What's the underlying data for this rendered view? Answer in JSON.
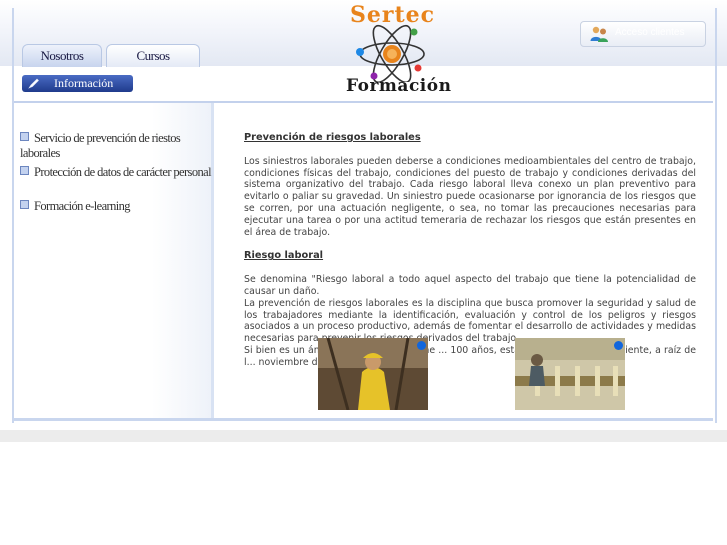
{
  "tabs": [
    {
      "label": "Nosotros",
      "active": true
    },
    {
      "label": "Cursos",
      "active": false
    }
  ],
  "infobar": {
    "label": "Información",
    "icon": "pencil-icon"
  },
  "logo": {
    "line1": "Sertec",
    "line2": "Formación",
    "icon": "atom-icon"
  },
  "client_button": {
    "icon": "users-icon",
    "label": "Acceso clientes"
  },
  "sidebar": {
    "items": [
      {
        "label": "Servicio de prevención de riestos laborales"
      },
      {
        "label": "Protección de datos de carácter personal"
      },
      {
        "label": "Formación e-learning"
      }
    ]
  },
  "content": {
    "heading1": "Prevención de riesgos laborales",
    "para1": "Los siniestros laborales pueden deberse a condiciones medioambientales del centro de trabajo, condiciones físicas del trabajo, condiciones del puesto de trabajo y condiciones derivadas del sistema organizativo del trabajo. Cada riesgo laboral lleva conexo un plan preventivo para evitarlo o paliar su gravedad. Un siniestro puede ocasionarse por ignorancia de los riesgos que se corren, por una actuación negligente, o sea, no tomar las precauciones necesarias para ejecutar una tarea o por una actitud temeraria de rechazar los riesgos que están presentes en el área de trabajo.",
    "heading2": "Riesgo laboral",
    "para2": "Se denomina \"Riesgo laboral a todo aquel aspecto del trabajo que tiene la potencialidad de causar un daño.",
    "para3": "La prevención de riesgos laborales es la disciplina que busca promover la seguridad y salud de los trabajadores mediante la identificación, evaluación y control de los peligros y riesgos asociados a un proceso productivo, además de fomentar el desarrollo de actividades y medidas necesarias para prevenir los riesgos derivados del trabajo.",
    "para4": "Si bien es un ámbito ... en España, tiene ... 100 años, esta denominación h... reciente, a raíz de l... noviembre de"
  },
  "photos": [
    {
      "name": "fisherman-photo"
    },
    {
      "name": "boat-photo"
    }
  ],
  "colors": {
    "accent": "#1f3b8c",
    "frame": "#c9d6ee",
    "logo_orange": "#e8841c",
    "dot_blue": "#1166dd"
  }
}
